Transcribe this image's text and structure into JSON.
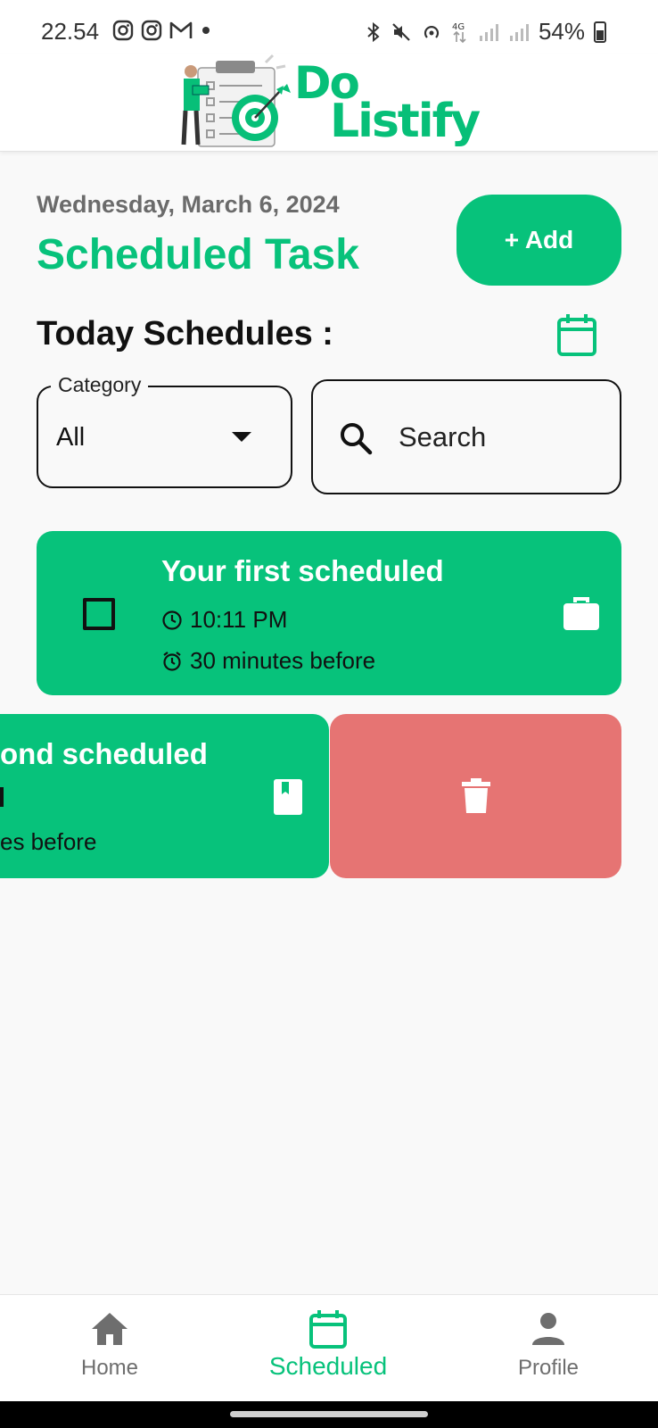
{
  "status_bar": {
    "time": "22.54",
    "battery": "54%",
    "network": "4G"
  },
  "header": {
    "logo_line1": "Do",
    "logo_line2": "Listify"
  },
  "main": {
    "date": "Wednesday, March 6, 2024",
    "title": "Scheduled Task",
    "add_label": "+ Add",
    "section_title": "Today Schedules :",
    "category": {
      "label": "Category",
      "value": "All"
    },
    "search": {
      "placeholder": "Search"
    }
  },
  "tasks": [
    {
      "title": "Your first scheduled",
      "time": "10:11 PM",
      "reminder": "30 minutes before",
      "category_icon": "briefcase-icon",
      "checked": false
    },
    {
      "title": "ond scheduled",
      "time": "",
      "reminder": "es before",
      "category_icon": "book-icon",
      "swiped": true
    }
  ],
  "bottom_nav": {
    "items": [
      {
        "label": "Home",
        "icon": "home-icon"
      },
      {
        "label": "Scheduled",
        "icon": "calendar-icon",
        "active": true
      },
      {
        "label": "Profile",
        "icon": "person-icon"
      }
    ]
  },
  "colors": {
    "accent": "#07c27b",
    "delete": "#e67473",
    "muted_text": "#6b6b6b"
  }
}
